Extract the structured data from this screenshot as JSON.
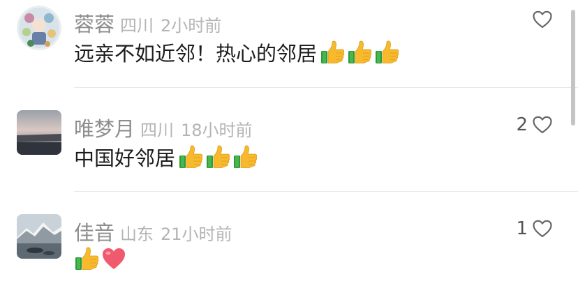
{
  "comments": [
    {
      "name": "蓉蓉",
      "region": "四川",
      "time": "2小时前",
      "text": "远亲不如近邻！热心的邻居",
      "emojis": [
        "thumbs-up",
        "thumbs-up",
        "thumbs-up"
      ],
      "likes": ""
    },
    {
      "name": "唯梦月",
      "region": "四川",
      "time": "18小时前",
      "text": "中国好邻居",
      "emojis": [
        "thumbs-up",
        "thumbs-up",
        "thumbs-up"
      ],
      "likes": "2"
    },
    {
      "name": "佳音",
      "region": "山东",
      "time": "21小时前",
      "text": "",
      "emojis": [
        "thumbs-up",
        "red-heart"
      ],
      "likes": "1"
    }
  ],
  "icons": {
    "like": "heart-outline-icon",
    "thumbs_up": "thumbs-up-icon",
    "heart": "red-heart-icon"
  },
  "colors": {
    "name": "#8d8d8d",
    "meta": "#b4b4b4",
    "text": "#1c1c1c",
    "divider": "#e8e8e8"
  }
}
